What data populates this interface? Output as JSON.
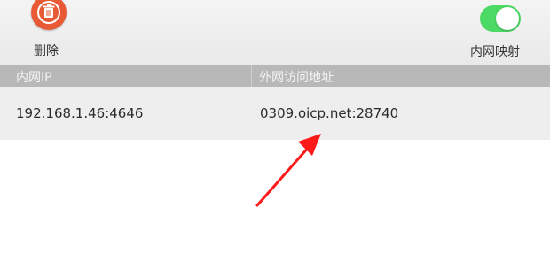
{
  "toolbar": {
    "delete_label": "删除",
    "delete_icon": "trash-icon",
    "mapping_label": "内网映射",
    "mapping_enabled": true
  },
  "table": {
    "columns": [
      "内网IP",
      "外网访问地址"
    ],
    "rows": [
      {
        "internal_ip": "192.168.1.46:4646",
        "external_address": "0309.oicp.net:28740"
      }
    ]
  },
  "colors": {
    "delete_button": "#e85a36",
    "toggle_on": "#4cd964",
    "header_bg": "#b8b8b8",
    "row_bg": "#eeeeee",
    "annotation_arrow": "#ff1a1a"
  }
}
